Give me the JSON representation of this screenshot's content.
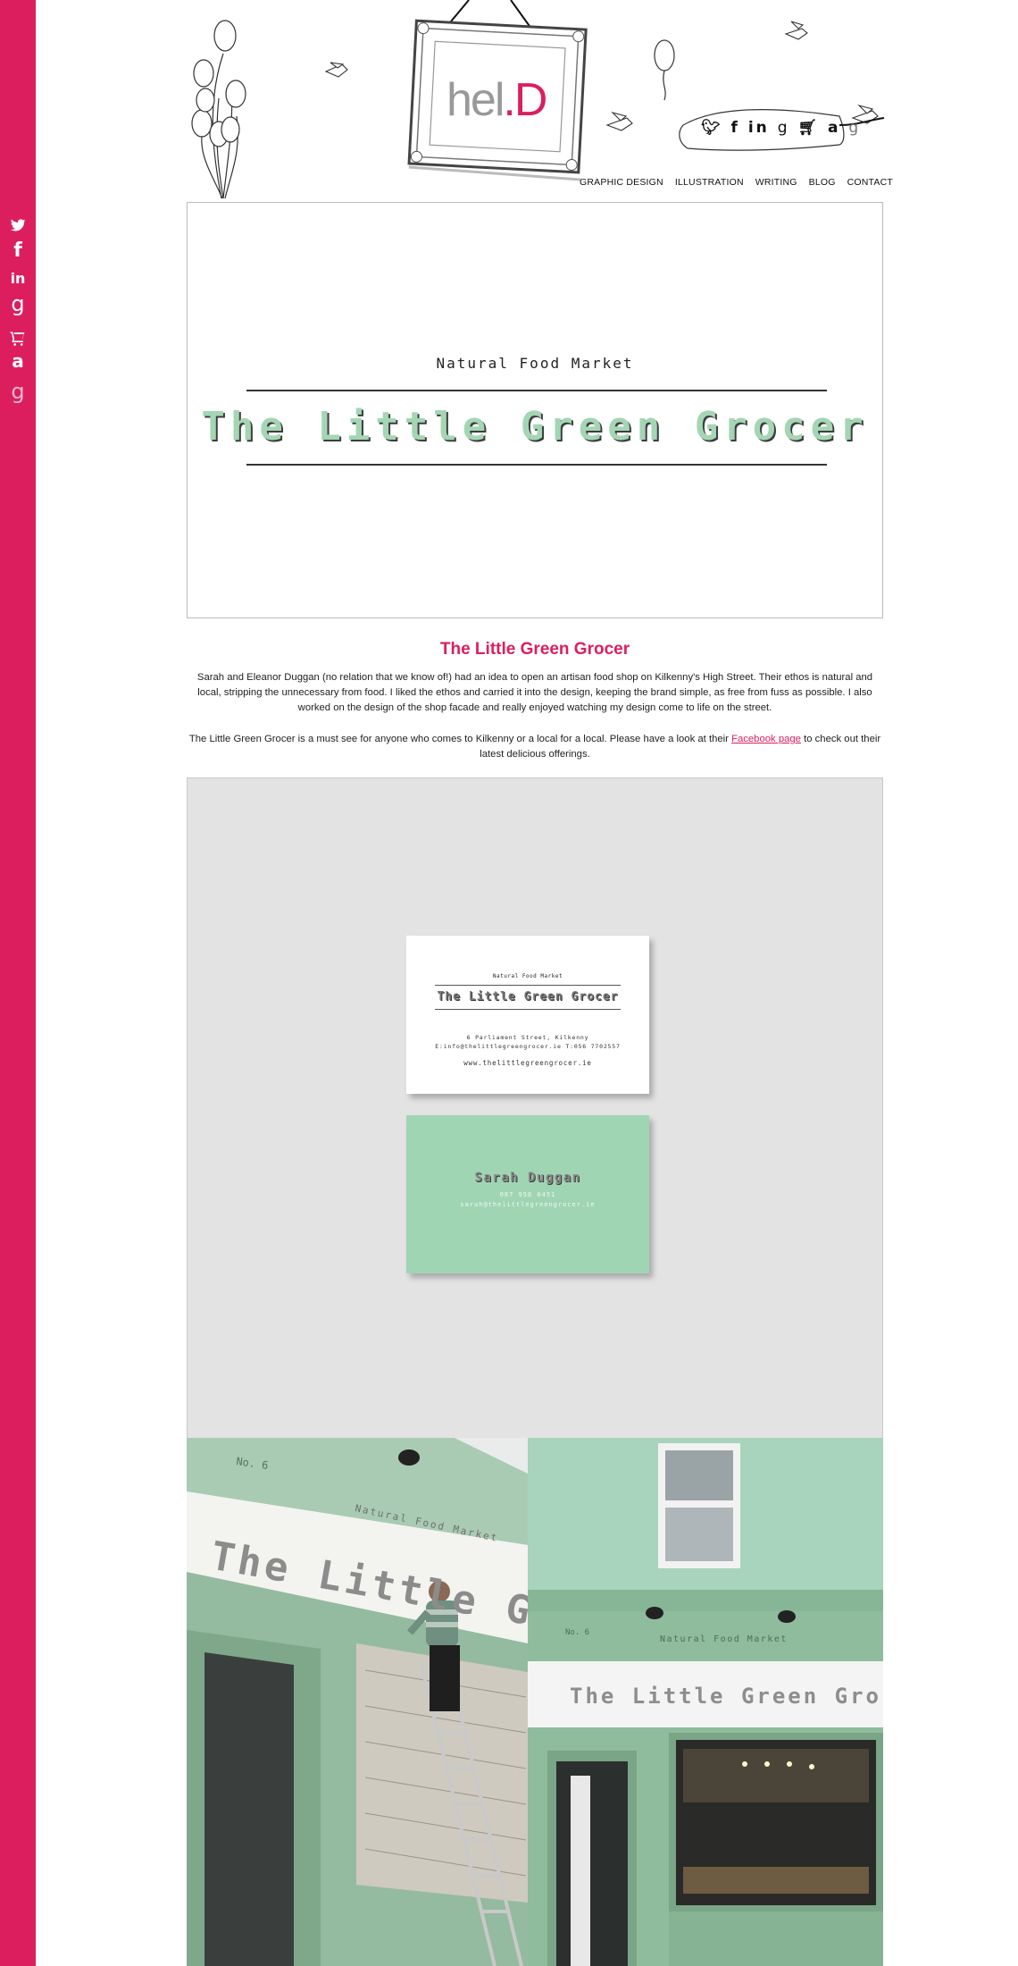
{
  "sidebar": {
    "icons": [
      {
        "name": "twitter-icon"
      },
      {
        "name": "facebook-icon",
        "glyph": "f"
      },
      {
        "name": "linkedin-icon",
        "glyph": "in"
      },
      {
        "name": "google-icon",
        "glyph": "g"
      },
      {
        "name": "cart-icon"
      },
      {
        "name": "amazon-icon",
        "glyph": "a"
      },
      {
        "name": "goodreads-icon",
        "glyph": "g"
      }
    ],
    "color": "#dc1e5e"
  },
  "header": {
    "logo": {
      "prefix": "hel",
      "suffix": ".D"
    },
    "banner_icons": {
      "facebook": "f",
      "linkedin": "in",
      "google": "g",
      "amazon": "a",
      "goodreads": "g"
    },
    "nav": [
      "GRAPHIC DESIGN",
      "ILLUSTRATION",
      "WRITING",
      "BLOG",
      "CONTACT"
    ]
  },
  "hero": {
    "subtitle": "Natural Food Market",
    "title": "The Little Green Grocer"
  },
  "project": {
    "heading": "The Little Green Grocer",
    "paragraph1": "Sarah and Eleanor Duggan  (no relation that we know of!) had an idea to open an artisan food shop on Kilkenny's High Street. Their ethos is natural and local, stripping the unnecessary from food. I liked the ethos and carried it into the design, keeping the brand simple, as free from fuss as possible. I also worked on the design of the shop facade and really enjoyed watching my design come to life on the street.",
    "paragraph2_before": "The Little Green Grocer is a must see for anyone who comes to Kilkenny or a local for a local. Please have a look at their ",
    "paragraph2_link": "Facebook page",
    "paragraph2_after": " to check out their latest delicious offerings."
  },
  "business_card_front": {
    "subtitle": "Natural Food Market",
    "title": "The Little Green Grocer",
    "address": "6 Parliament Street, Kilkenny",
    "contact": "E:info@thelittlegreengrocer.ie T:056 7702557",
    "website": "www.thelittlegreengrocer.ie"
  },
  "business_card_back": {
    "name": "Sarah Duggan",
    "phone": "087 956 0451",
    "email": "sarah@thelittlegreengrocer.ie"
  },
  "shopfront": {
    "number_left": "No. 6",
    "number_right": "No. 6",
    "market_label": "Natural Food Market",
    "sign_left": "The Little Gre",
    "sign_right": "The Little Green Grocer"
  },
  "colors": {
    "accent": "#dc1e5e",
    "mint": "#a0d5b4",
    "facade": "#8fbc9c"
  }
}
